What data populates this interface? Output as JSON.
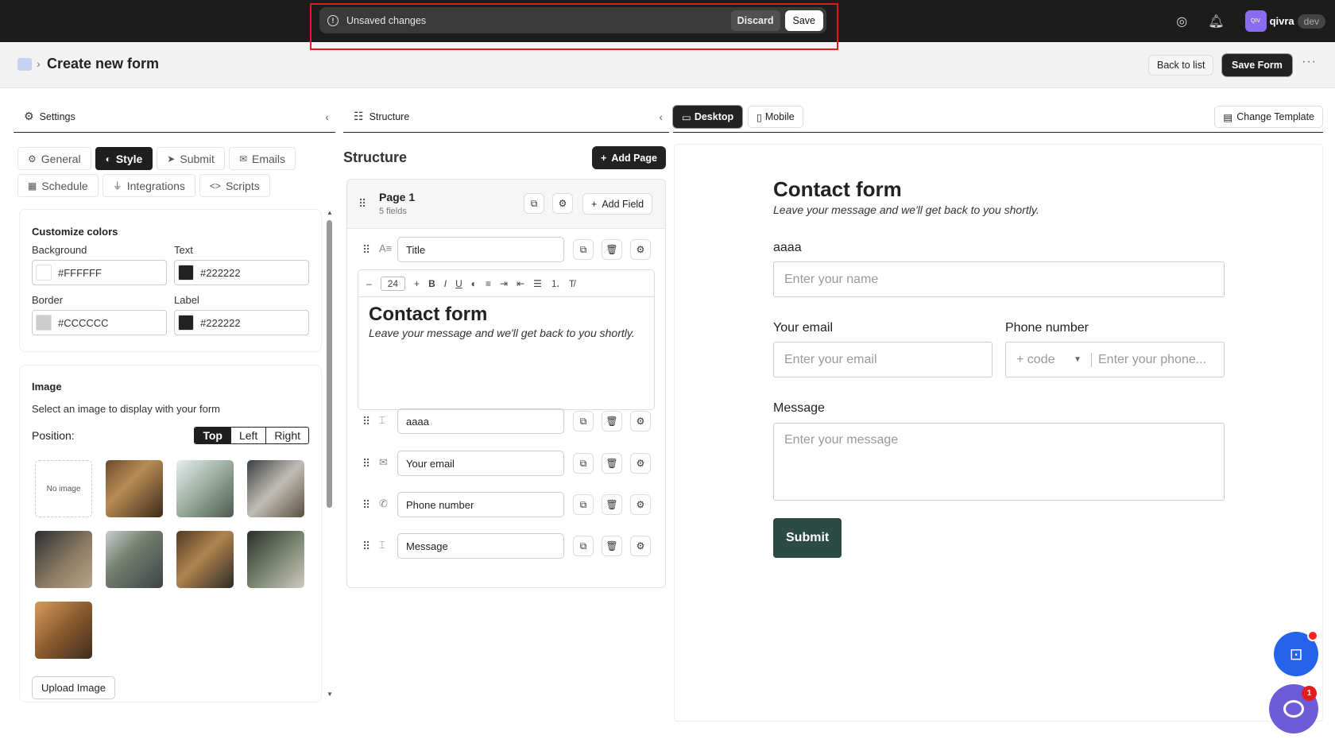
{
  "topbar": {
    "unsaved_text": "Unsaved changes",
    "discard_label": "Discard",
    "save_label": "Save",
    "user_initials": "QIV",
    "username": "qivra",
    "env_badge": "dev"
  },
  "header": {
    "title": "Create new form",
    "back_label": "Back to list",
    "save_form_label": "Save Form",
    "more": "···"
  },
  "settings": {
    "panel_title": "Settings",
    "tabs": [
      {
        "label": "General",
        "icon": "gear-icon"
      },
      {
        "label": "Style",
        "icon": "palette-icon",
        "active": true
      },
      {
        "label": "Submit",
        "icon": "send-icon"
      },
      {
        "label": "Emails",
        "icon": "mail-icon"
      },
      {
        "label": "Schedule",
        "icon": "calendar-icon"
      },
      {
        "label": "Integrations",
        "icon": "plug-icon"
      },
      {
        "label": "Scripts",
        "icon": "code-icon"
      }
    ],
    "colors": {
      "title": "Customize colors",
      "background_label": "Background",
      "background_value": "#FFFFFF",
      "text_label": "Text",
      "text_value": "#222222",
      "border_label": "Border",
      "border_value": "#CCCCCC",
      "label_label": "Label",
      "label_value": "#222222"
    },
    "image": {
      "title": "Image",
      "description": "Select an image to display with your form",
      "position_label": "Position:",
      "positions": [
        "Top",
        "Left",
        "Right"
      ],
      "selected_position": "Top",
      "no_image_label": "No image",
      "upload_label": "Upload Image"
    }
  },
  "structure": {
    "panel_title": "Structure",
    "heading": "Structure",
    "add_page_label": "Add Page",
    "page": {
      "name": "Page 1",
      "count": "5 fields",
      "add_field_label": "Add Field"
    },
    "fields": [
      {
        "label": "Title",
        "icon": "heading-icon"
      },
      {
        "label": "aaaa",
        "icon": "text-input-icon"
      },
      {
        "label": "Your email",
        "icon": "mail-icon"
      },
      {
        "label": "Phone number",
        "icon": "phone-icon"
      },
      {
        "label": "Message",
        "icon": "text-input-icon"
      }
    ],
    "editor": {
      "font_size": "24",
      "title": "Contact form",
      "subtitle": "Leave your message and we'll get back to you shortly."
    }
  },
  "preview": {
    "desktop_label": "Desktop",
    "mobile_label": "Mobile",
    "change_template_label": "Change Template",
    "form_title": "Contact form",
    "form_subtitle": "Leave your message and we'll get back to you shortly.",
    "name_label": "aaaa",
    "name_placeholder": "Enter your name",
    "email_label": "Your email",
    "email_placeholder": "Enter your email",
    "phone_label": "Phone number",
    "phone_code_placeholder": "+ code",
    "phone_placeholder": "Enter your phone...",
    "message_label": "Message",
    "message_placeholder": "Enter your message",
    "submit_label": "Submit"
  },
  "widgets": {
    "chat_badge": "1"
  },
  "colors": {
    "accent_dark": "#222222",
    "submit_bg": "#2d4b45",
    "highlight_outline": "#e01b1b",
    "bot_fab": "#2563eb",
    "chat_fab": "#6e5bd8"
  }
}
